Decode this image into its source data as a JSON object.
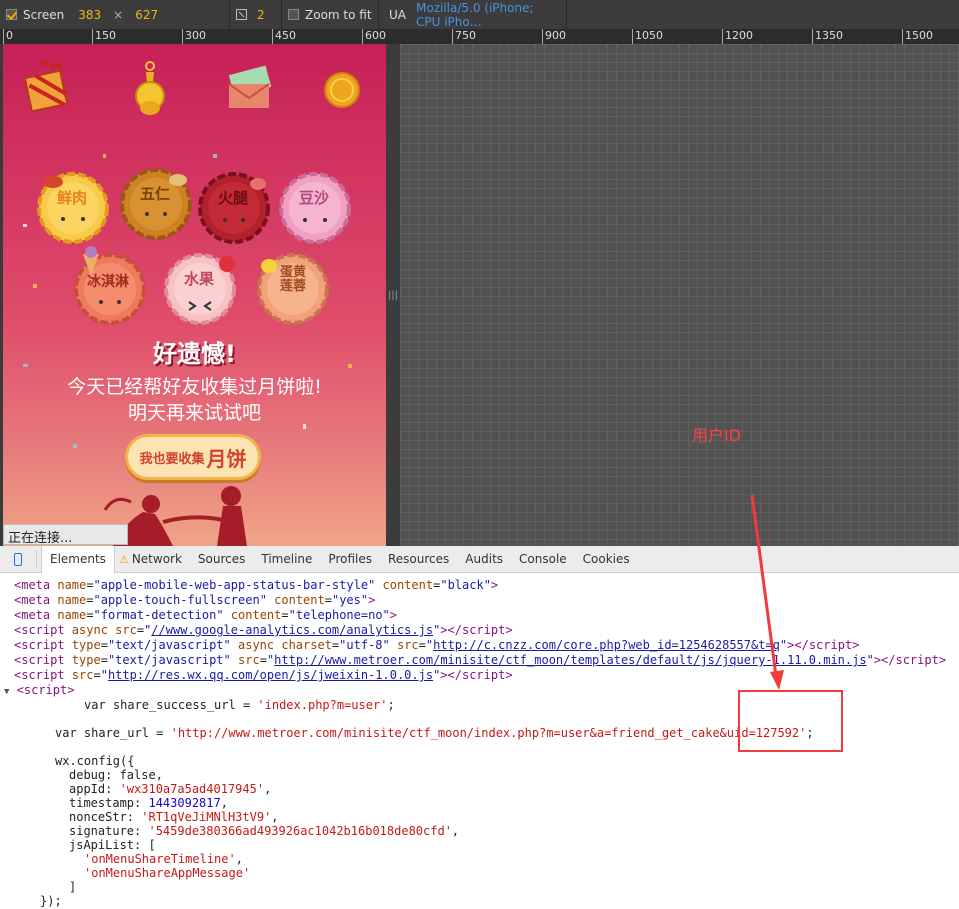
{
  "toolbar": {
    "screen_label": "Screen",
    "width": "383",
    "times": "×",
    "height": "627",
    "ratio": "2",
    "zoom_label": "Zoom to fit",
    "ua_label": "UA",
    "ua_value": "Mozilla/5.0 (iPhone; CPU iPho…"
  },
  "ruler": [
    "0",
    "150",
    "300",
    "450",
    "600",
    "750",
    "900",
    "1050",
    "1200",
    "1350",
    "1500"
  ],
  "phone": {
    "flavors_row1": [
      "鲜肉",
      "五仁",
      "火腿",
      "豆沙"
    ],
    "flavors_row2": [
      "冰淇淋",
      "水果",
      "蛋黄莲蓉"
    ],
    "sorry_title": "好遗憾!",
    "message1": "今天已经帮好友收集过月饼啦!",
    "message2": "明天再来试试吧",
    "cta_small": "我也要收集",
    "cta_big": "月饼"
  },
  "status_text": "正在连接...",
  "annotation": "用户ID",
  "devtools": {
    "tabs": [
      "Elements",
      "Network",
      "Sources",
      "Timeline",
      "Profiles",
      "Resources",
      "Audits",
      "Console",
      "Cookies"
    ],
    "code": {
      "meta1_name": "apple-mobile-web-app-status-bar-style",
      "meta1_content": "black",
      "meta2_name": "apple-touch-fullscreen",
      "meta2_content": "yes",
      "meta3_name": "format-detection",
      "meta3_content": "telephone=no",
      "script1_src": "//www.google-analytics.com/analytics.js",
      "script2_src": "http://c.cnzz.com/core.php?web_id=1254628557&t=q",
      "script3_src": "http://www.metroer.com/minisite/ctf_moon/templates/default/js/jquery-1.11.0.min.js",
      "script4_src": "http://res.wx.qq.com/open/js/jweixin-1.0.0.js",
      "share_success_url": "'index.php?m=user'",
      "share_url": "'http://www.metroer.com/minisite/ctf_moon/index.php?m=user&a=friend_get_cake&uid=127592'",
      "debug": "false",
      "appId": "'wx310a7a5ad4017945'",
      "timestamp": "1443092817",
      "nonceStr": "'RT1qVeJiMNlH3tV9'",
      "signature": "'5459de380366ad493926ac1042b16b018de80cfd'",
      "api1": "'onMenuShareTimeline'",
      "api2": "'onMenuShareAppMessage'"
    }
  }
}
